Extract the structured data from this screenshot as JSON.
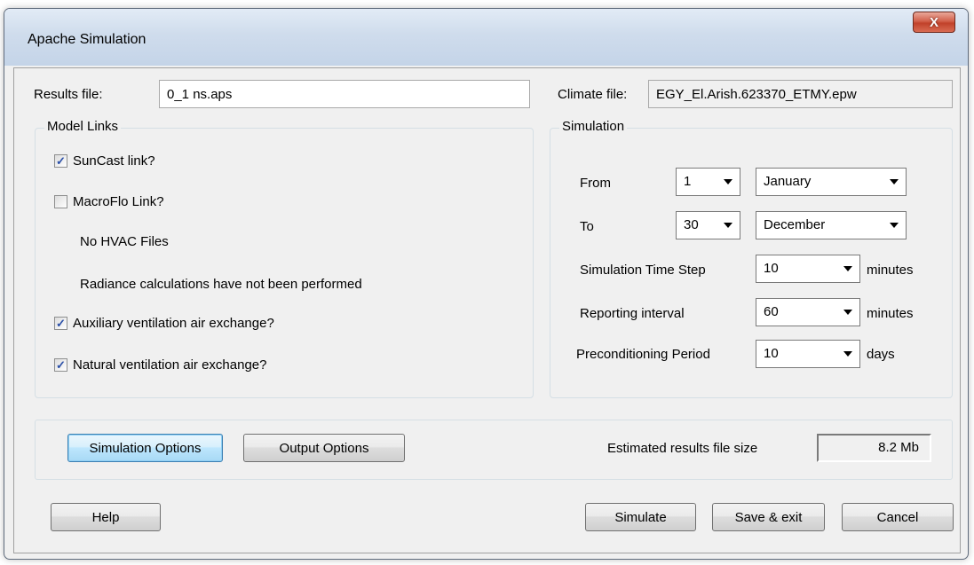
{
  "window": {
    "title": "Apache Simulation",
    "close_glyph": "X"
  },
  "results_file": {
    "label": "Results file:",
    "value": "0_1 ns.aps"
  },
  "climate_file": {
    "label": "Climate file:",
    "value": "EGY_El.Arish.623370_ETMY.epw"
  },
  "model_links": {
    "title": "Model Links",
    "suncast": {
      "label": "SunCast link?",
      "checked": true
    },
    "macroflo": {
      "label": "MacroFlo Link?",
      "checked": false
    },
    "hvac_note": "No HVAC Files",
    "radiance_note": "Radiance calculations have not been performed",
    "aux_vent": {
      "label": "Auxiliary ventilation air exchange?",
      "checked": true
    },
    "nat_vent": {
      "label": "Natural ventilation air exchange?",
      "checked": true
    }
  },
  "simulation": {
    "title": "Simulation",
    "from_label": "From",
    "from_day": "1",
    "from_month": "January",
    "to_label": "To",
    "to_day": "30",
    "to_month": "December",
    "time_step_label": "Simulation Time Step",
    "time_step": "10",
    "time_step_unit": "minutes",
    "reporting_label": "Reporting interval",
    "reporting": "60",
    "reporting_unit": "minutes",
    "precond_label": "Preconditioning Period",
    "precond": "10",
    "precond_unit": "days"
  },
  "options": {
    "sim_options_label": "Simulation Options",
    "output_options_label": "Output Options",
    "est_size_label": "Estimated results file size",
    "est_size_value": "8.2 Mb"
  },
  "footer": {
    "help_label": "Help",
    "simulate_label": "Simulate",
    "save_exit_label": "Save & exit",
    "cancel_label": "Cancel"
  },
  "colors": {
    "check_mark": "#2a4fa8",
    "close_button": "#c1412a",
    "focus_button": "#3c7fb1"
  },
  "icons": {
    "check": "check-icon",
    "dropdown": "chevron-down-icon",
    "close": "close-icon"
  }
}
